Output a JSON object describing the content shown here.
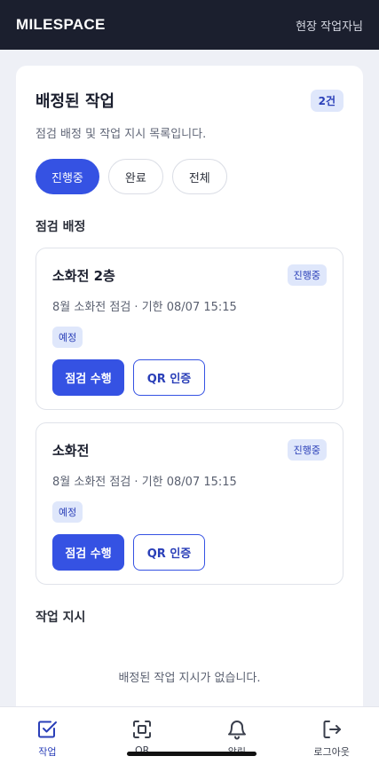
{
  "header": {
    "brand": "MILESPACE",
    "user": "현장 작업자님"
  },
  "card": {
    "title": "배정된 작업",
    "count_badge": "2건",
    "description": "점검 배정 및 작업 지시 목록입니다."
  },
  "filters": [
    {
      "label": "진행중",
      "active": true
    },
    {
      "label": "완료",
      "active": false
    },
    {
      "label": "전체",
      "active": false
    }
  ],
  "sections": {
    "inspections_title": "점검 배정",
    "work_orders_title": "작업 지시",
    "work_orders_empty": "배정된 작업 지시가 없습니다."
  },
  "inspections": [
    {
      "title": "소화전 2층",
      "status": "진행중",
      "meta": "8월 소화전 점검 · 기한 08/07 15:15",
      "tag": "예정",
      "primary_action": "점검 수행",
      "secondary_action": "QR 인증"
    },
    {
      "title": "소화전",
      "status": "진행중",
      "meta": "8월 소화전 점검 · 기한 08/07 15:15",
      "tag": "예정",
      "primary_action": "점검 수행",
      "secondary_action": "QR 인증"
    }
  ],
  "bottom_nav": [
    {
      "label": "작업",
      "icon": "checkbox-icon",
      "active": true
    },
    {
      "label": "QR",
      "icon": "qr-scan-icon",
      "active": false
    },
    {
      "label": "알림",
      "icon": "bell-icon",
      "active": false
    },
    {
      "label": "로그아웃",
      "icon": "logout-icon",
      "active": false
    }
  ],
  "colors": {
    "accent": "#3552e3",
    "header_bg": "#1b1f2e",
    "badge_bg": "#dfe7fb",
    "badge_text": "#2a3fb8"
  }
}
